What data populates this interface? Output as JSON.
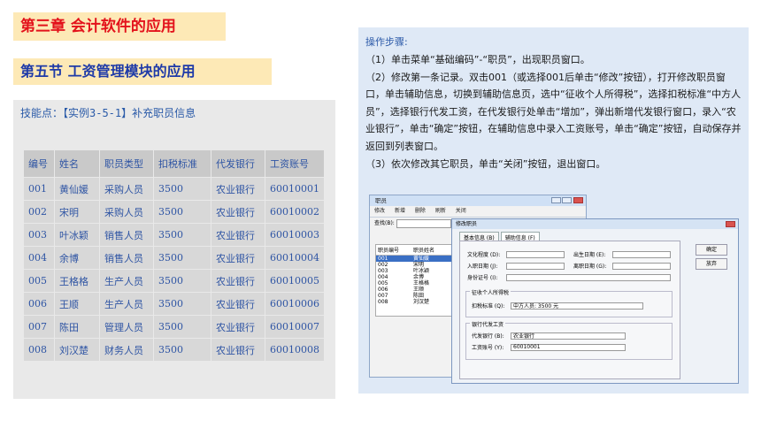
{
  "chapter_title": "第三章 会计软件的应用",
  "section_title": "第五节 工资管理模块的应用",
  "skill_point": "技能点：【实例3-5-1】补充职员信息",
  "table": {
    "headers": [
      "编号",
      "姓名",
      "职员类型",
      "扣税标准",
      "代发银行",
      "工资账号"
    ],
    "rows": [
      [
        "001",
        "黄仙媛",
        "采购人员",
        "3500",
        "农业银行",
        "60010001"
      ],
      [
        "002",
        "宋明",
        "采购人员",
        "3500",
        "农业银行",
        "60010002"
      ],
      [
        "003",
        "叶冰颖",
        "销售人员",
        "3500",
        "农业银行",
        "60010003"
      ],
      [
        "004",
        "余博",
        "销售人员",
        "3500",
        "农业银行",
        "60010004"
      ],
      [
        "005",
        "王格格",
        "生产人员",
        "3500",
        "农业银行",
        "60010005"
      ],
      [
        "006",
        "王顺",
        "生产人员",
        "3500",
        "农业银行",
        "60010006"
      ],
      [
        "007",
        "陈田",
        "管理人员",
        "3500",
        "农业银行",
        "60010007"
      ],
      [
        "008",
        "刘汉楚",
        "财务人员",
        "3500",
        "农业银行",
        "60010008"
      ]
    ]
  },
  "steps": {
    "title": "操作步骤:",
    "items": [
      "（1）单击菜单“基础编码”-“职员”，出现职员窗口。",
      "（2）修改第一条记录。双击001（或选择001后单击“修改”按钮），打开修改职员窗口，单击辅助信息，切换到辅助信息页，选中“征收个人所得税”，选择扣税标准“中方人员”，选择银行代发工资，在代发银行处单击“增加”，弹出新增代发银行窗口，录入“农业银行”，单击“确定”按钮，在辅助信息中录入工资账号，单击“确定”按钮，自动保存并返回到列表窗口。",
      "（3）依次修改其它职员，单击“关闭”按钮，退出窗口。"
    ]
  },
  "window": {
    "title": "职员",
    "toolbar": [
      "修改",
      "新增",
      "删除",
      "刷新",
      "关闭"
    ],
    "search_label": "查找(B):",
    "list_headers": [
      "职员编号",
      "职员姓名"
    ],
    "list_rows": [
      [
        "001",
        "黄仙媛"
      ],
      [
        "002",
        "宋明"
      ],
      [
        "003",
        "叶冰颖"
      ],
      [
        "004",
        "余博"
      ],
      [
        "005",
        "王格格"
      ],
      [
        "006",
        "王顺"
      ],
      [
        "007",
        "陈田"
      ],
      [
        "008",
        "刘汉楚"
      ]
    ]
  },
  "dialog": {
    "title": "修改职员",
    "tabs": [
      "基本信息 (B)",
      "辅助信息 (F)"
    ],
    "confirm": "确定",
    "cancel": "放弃",
    "culture_label": "文化程度 (D):",
    "birth_label": "出生日期 (E):",
    "join_label": "入职日期 (J):",
    "leave_label": "离职日期 (G):",
    "id_label": "身份证号 (I):",
    "tax_group": "征收个人所得税",
    "tax_label": "扣税标准 (Q):",
    "tax_value": "中方人员:  3500 元",
    "bank_group": "银行代发工资",
    "bank_label": "代发银行 (B):",
    "bank_value": "农业银行",
    "account_label": "工资账号 (Y):",
    "account_value": "60010001"
  }
}
